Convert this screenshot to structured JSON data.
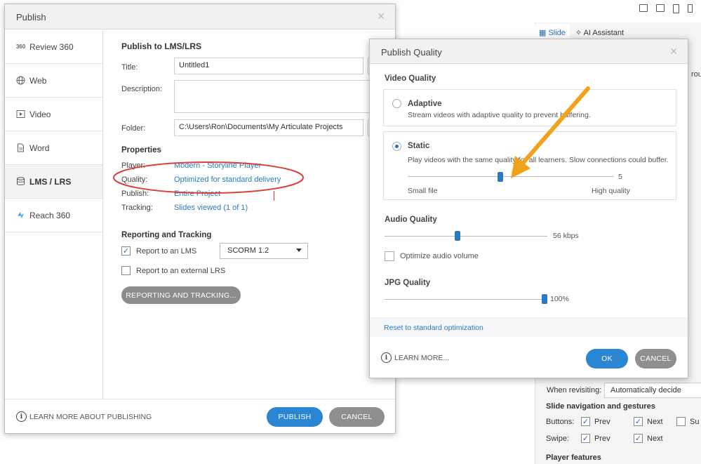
{
  "background": {
    "tabs": [
      "Slide",
      "AI Assistant"
    ],
    "group_fragment": "roup",
    "when_revisiting": {
      "label": "When revisiting:",
      "value": "Automatically decide"
    },
    "slide_nav_heading": "Slide navigation and gestures",
    "buttons_row": {
      "label": "Buttons:",
      "prev": "Prev",
      "next": "Next",
      "submit_fragment": "Su"
    },
    "swipe_row": {
      "label": "Swipe:",
      "prev": "Prev",
      "next": "Next"
    },
    "player_features": "Player features",
    "top_icons": [
      "desktop-icon",
      "tablet-landscape-icon",
      "tablet-portrait-icon",
      "phone-icon"
    ]
  },
  "publish": {
    "title": "Publish",
    "sidebar": [
      {
        "label": "Review 360",
        "icon": "review-360-icon"
      },
      {
        "label": "Web",
        "icon": "globe-icon"
      },
      {
        "label": "Video",
        "icon": "video-icon"
      },
      {
        "label": "Word",
        "icon": "word-doc-icon"
      },
      {
        "label": "LMS / LRS",
        "icon": "database-icon",
        "active": true
      },
      {
        "label": "Reach 360",
        "icon": "reach-360-icon"
      }
    ],
    "section_title": "Publish to LMS/LRS",
    "title_label": "Title:",
    "title_value": "Untitled1",
    "description_label": "Description:",
    "folder_label": "Folder:",
    "folder_value": "C:\\Users\\Ron\\Documents\\My Articulate Projects",
    "properties_heading": "Properties",
    "player_label": "Player:",
    "player_value": "Modern - Storyline Player",
    "quality_label": "Quality:",
    "quality_value": "Optimized for standard delivery",
    "publish_label": "Publish:",
    "publish_value": "Entire Project",
    "tracking_label": "Tracking:",
    "tracking_value": "Slides viewed (1 of 1)",
    "reporting_heading": "Reporting and Tracking",
    "report_lms_label": "Report to an LMS",
    "report_lms_checked": true,
    "lms_standard": "SCORM 1.2",
    "report_lrs_label": "Report to an external LRS",
    "report_lrs_checked": false,
    "reporting_button": "REPORTING AND TRACKING...",
    "learn_more": "LEARN MORE ABOUT PUBLISHING",
    "publish_button": "PUBLISH",
    "cancel_button": "CANCEL"
  },
  "quality": {
    "title": "Publish Quality",
    "video_heading": "Video Quality",
    "adaptive_title": "Adaptive",
    "adaptive_desc": "Stream videos with adaptive quality to prevent buffering.",
    "static_title": "Static",
    "static_desc": "Play videos with the same quality for all learners. Slow connections could buffer.",
    "static_value": "5",
    "static_slider_fraction": 0.45,
    "small_file": "Small file",
    "high_quality": "High quality",
    "selected_mode": "static",
    "audio_heading": "Audio Quality",
    "audio_value": "56 kbps",
    "audio_slider_fraction": 0.45,
    "optimize_audio": "Optimize audio volume",
    "optimize_audio_checked": false,
    "jpg_heading": "JPG Quality",
    "jpg_value": "100%",
    "jpg_slider_fraction": 1.0,
    "reset_link": "Reset to standard optimization",
    "learn_more": "LEARN MORE...",
    "ok_button": "OK",
    "cancel_button": "CANCEL"
  },
  "colors": {
    "accent": "#2a85d3",
    "link": "#2a7abf",
    "annotation_ellipse": "#d9403a",
    "annotation_arrow": "#f0a21a"
  }
}
